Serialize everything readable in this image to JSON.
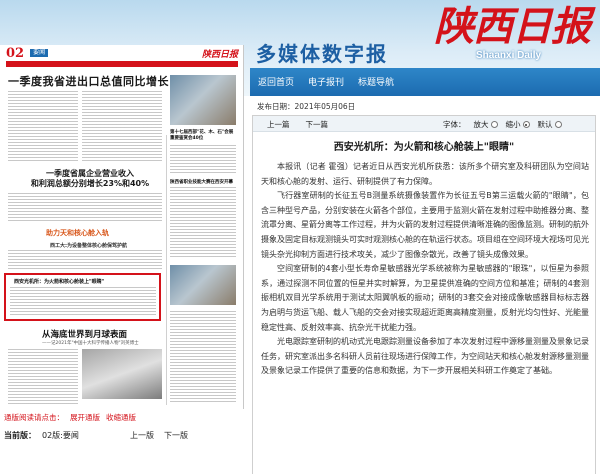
{
  "header": {
    "site_title": "多媒体数字报",
    "logo_cn": "陕西日报",
    "logo_en": "Shaanxi Daily",
    "nav": [
      "返回首页",
      "电子报刊",
      "标题导航"
    ]
  },
  "paper_thumb": {
    "page_number": "02",
    "section_label": "要闻",
    "logo": "陕西日报",
    "headline_main": "一季度我省进出口总值同比增长13.4%",
    "headline_sub": "一季度省属企业营业收入\n和利润总额分别增长23%和40%",
    "feature_title": "助力天和核心舱入轨",
    "feature_sub": "西工大:为设备整体核心舱保驾护航",
    "highlight_title": "西安光机所：为火箭和核心舱装上\"眼睛\"",
    "headline_bottom": "从海底世界到月球表面",
    "headline_bottom_sub": "——记2021年\"中国十大科学传播人物\"刘英博士",
    "side_title_1": "第十七届西部\"花、木、石\"会展\n重要鉴赏会40位",
    "side_title_2": "陕西省职业技能大赛在西安开幕"
  },
  "footer": {
    "download_label": "通版阅读请点击：",
    "open_label": "展开通版",
    "collapse_label": "收缩通版",
    "current_label": "当前版：",
    "current_page": "02版:要闻",
    "prev_page": "上一版",
    "next_page": "下一版"
  },
  "article": {
    "pubdate_label": "发布日期：",
    "pubdate": "2021年05月06日",
    "prev": "上一篇",
    "next": "下一篇",
    "font_label": "字体：",
    "font_options": [
      "放大",
      "缩小",
      "默认"
    ],
    "font_selected": 1,
    "title": "西安光机所：为火箭和核心舱装上\"眼睛\"",
    "paragraphs": [
      "本报讯（记者 霍强）记者近日从西安光机所获悉：该所多个研究室及科研团队为空间站天和核心舱的发射、运行、研制提供了有力保障。",
      "飞行器室研制的长征五号B测量系统摄像装置作为长征五号B第三运载火箭的\"眼睛\"，包含三种型号产品，分别安装在火箭各个部位，主要用于监测火箭在发射过程中助推器分离、整流罩分离、星箭分离等工作过程，并为火箭的发射过程提供清晰准确的图像监测。研制的航外摄象及固定目标观测镜头可实时观测核心舱的在轨运行状态。项目组在空间环境大视场可见光镜头杂光抑制方面进行技术攻关，减少了图像杂散光，改善了镜头成像效果。",
      "空间室研制的4套小型长寿命星敏感器光学系统被称为星敏感器的\"眼珠\"，以恒星为参照系，通过探测不同位置的恒星并实时解算，为卫星提供准确的空间方位和基准；研制的4套测振相机双目光学系统用于测试太阳翼帆板的振动；研制的3套交会对接成像敏感器目标标志器为启明与货运飞船、载人飞船的交会对接实现超近距离高精度测量，反射光均匀性好、光能量稳定性高、反射效率高、抗杂光干扰能力强。",
      "光电跟踪室研制的机动式光电跟踪测量设备参加了本次发射过程中源移量测量及景象记录任务，研究室派出多名科研人员前往现场进行保障工作，为空间站天和核心舱发射源移量测量及景象记录工作提供了重要的信息和数据，为下一步开展相关科研工作奠定了基础。"
    ]
  }
}
